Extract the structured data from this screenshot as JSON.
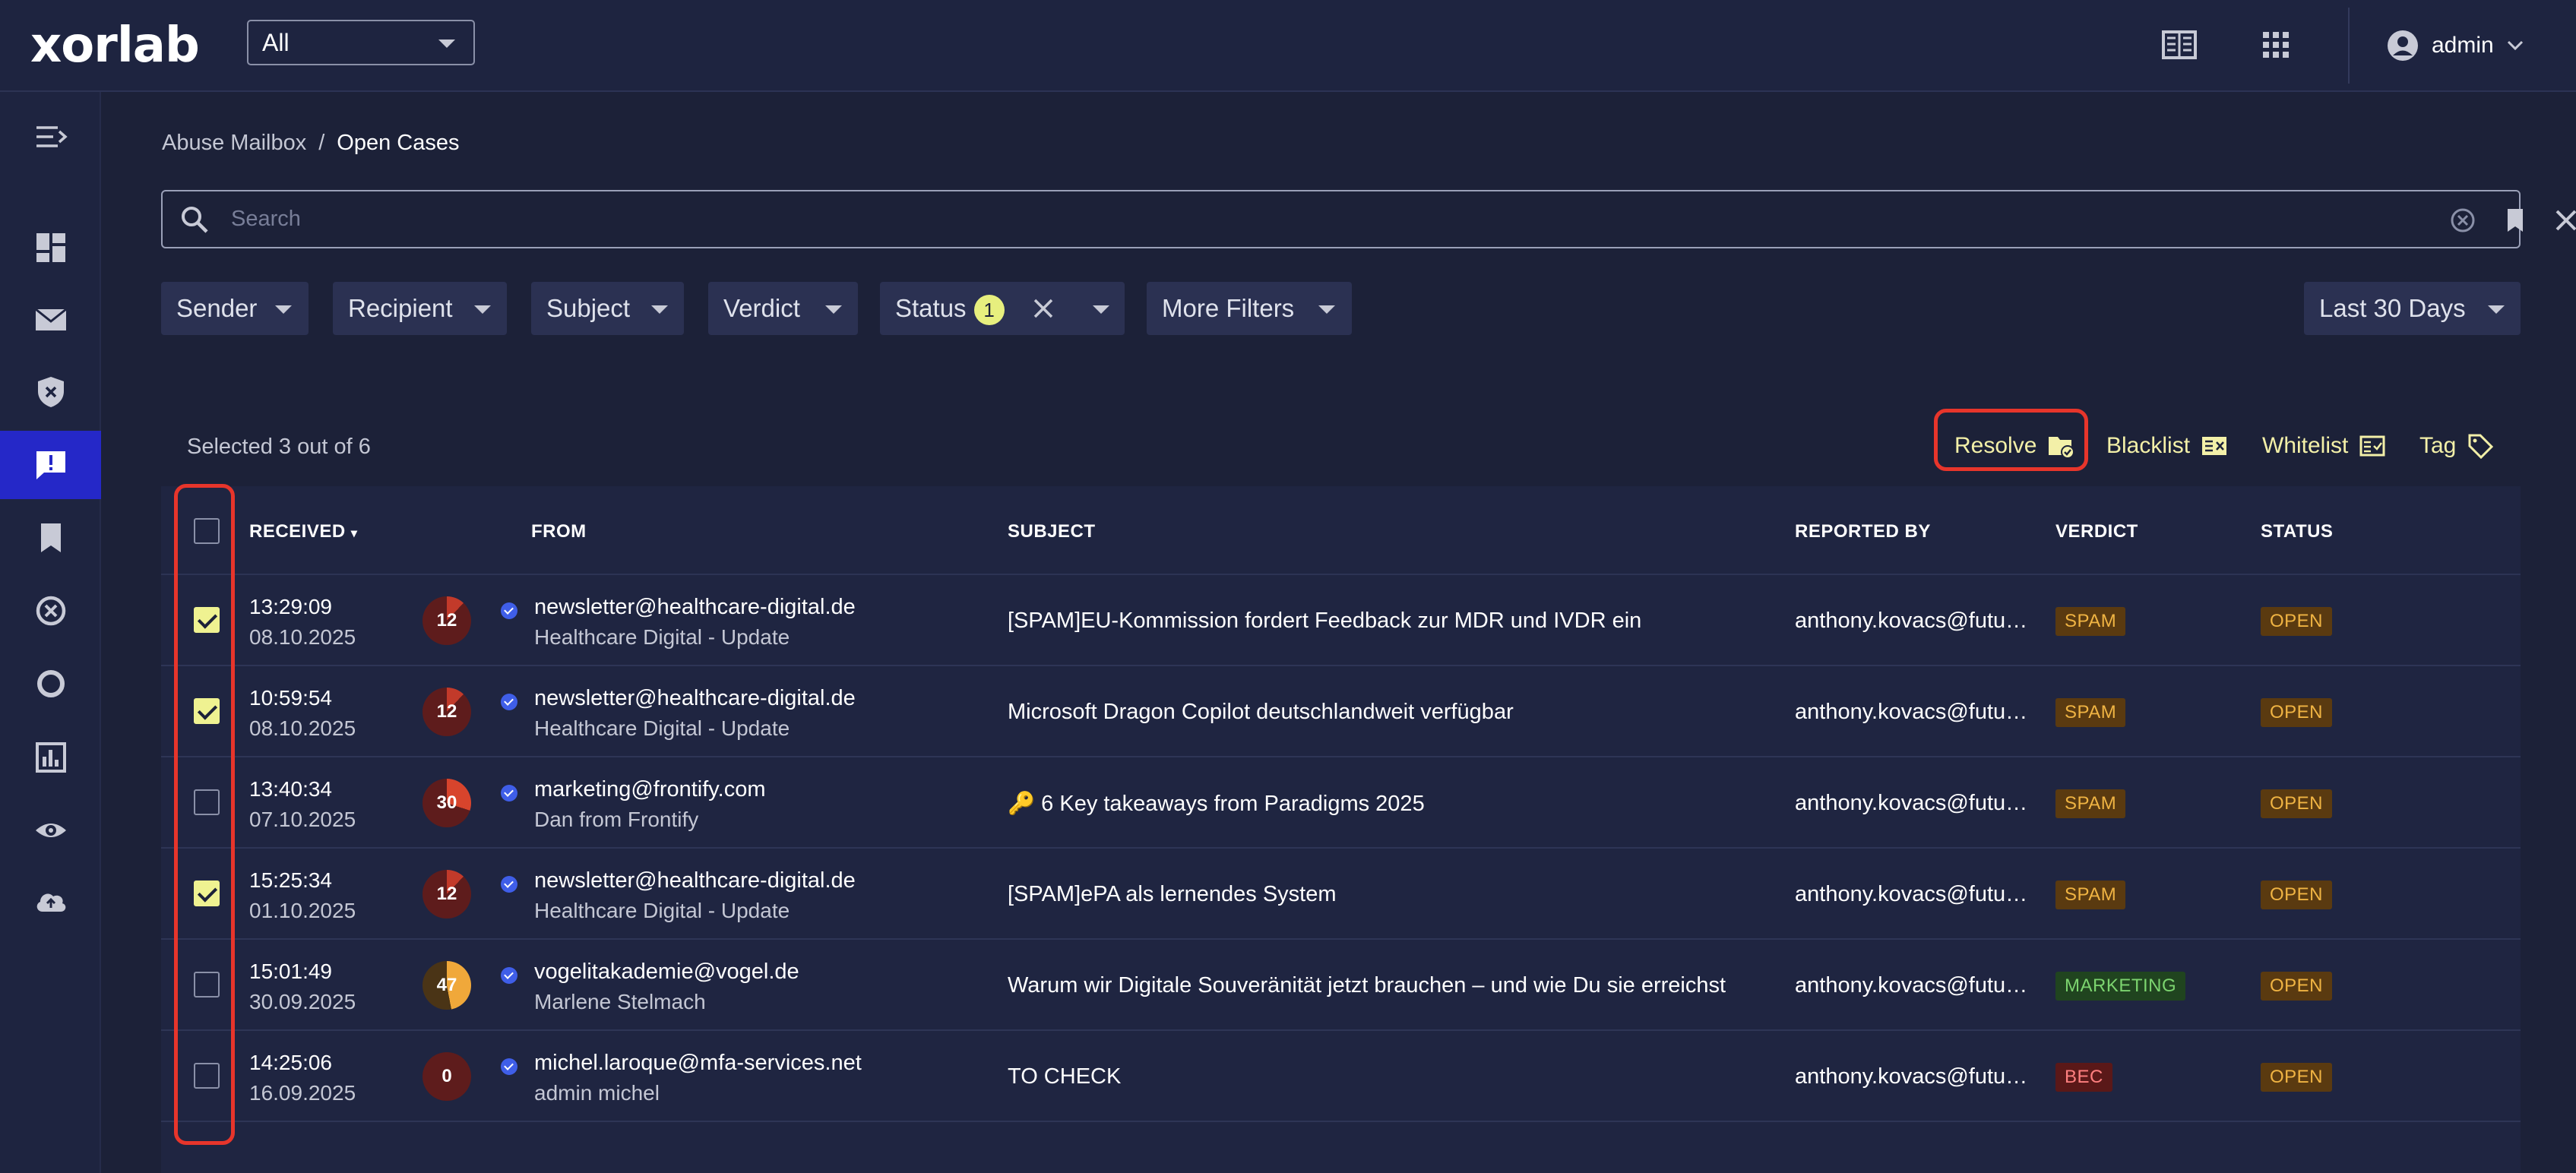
{
  "app": {
    "logo": "xorlab",
    "scope": "All",
    "user": "admin"
  },
  "breadcrumb": {
    "parent": "Abuse Mailbox",
    "separator": "/",
    "current": "Open Cases"
  },
  "search": {
    "placeholder": "Search"
  },
  "filters": {
    "sender": "Sender",
    "recipient": "Recipient",
    "subject": "Subject",
    "verdict": "Verdict",
    "status": "Status",
    "status_count": "1",
    "more": "More Filters",
    "range": "Last 30 Days"
  },
  "toolbar": {
    "selected": "Selected 3 out of 6",
    "resolve": "Resolve",
    "blacklist": "Blacklist",
    "whitelist": "Whitelist",
    "tag": "Tag"
  },
  "table": {
    "headers": {
      "received": "RECEIVED",
      "from": "FROM",
      "subject": "SUBJECT",
      "reported_by": "REPORTED BY",
      "verdict": "VERDICT",
      "status": "STATUS"
    },
    "rows": [
      {
        "time": "13:29:09",
        "date": "08.10.2025",
        "score": "12",
        "from_email": "newsletter@healthcare-digital.de",
        "from_name": "Healthcare Digital - Update",
        "subject": "[SPAM]EU-Kommission fordert Feedback zur MDR und IVDR ein",
        "reported_by": "anthony.kovacs@futur…",
        "verdict": "SPAM",
        "status": "OPEN"
      },
      {
        "time": "10:59:54",
        "date": "08.10.2025",
        "score": "12",
        "from_email": "newsletter@healthcare-digital.de",
        "from_name": "Healthcare Digital - Update",
        "subject": "Microsoft Dragon Copilot deutschlandweit verfügbar",
        "reported_by": "anthony.kovacs@futur…",
        "verdict": "SPAM",
        "status": "OPEN"
      },
      {
        "time": "13:40:34",
        "date": "07.10.2025",
        "score": "30",
        "from_email": "marketing@frontify.com",
        "from_name": "Dan from Frontify",
        "subject": "🔑 6 Key takeaways from Paradigms 2025",
        "reported_by": "anthony.kovacs@futur…",
        "verdict": "SPAM",
        "status": "OPEN"
      },
      {
        "time": "15:25:34",
        "date": "01.10.2025",
        "score": "12",
        "from_email": "newsletter@healthcare-digital.de",
        "from_name": "Healthcare Digital - Update",
        "subject": "[SPAM]ePA als lernendes System",
        "reported_by": "anthony.kovacs@futur…",
        "verdict": "SPAM",
        "status": "OPEN"
      },
      {
        "time": "15:01:49",
        "date": "30.09.2025",
        "score": "47",
        "from_email": "vogelitakademie@vogel.de",
        "from_name": "Marlene Stelmach",
        "subject": "Warum wir Digitale Souveränität jetzt brauchen – und wie Du sie erreichst",
        "reported_by": "anthony.kovacs@futur…",
        "verdict": "MARKETING",
        "status": "OPEN"
      },
      {
        "time": "14:25:06",
        "date": "16.09.2025",
        "score": "0",
        "from_email": "michel.laroque@mfa-services.net",
        "from_name": "admin michel",
        "subject": "TO CHECK",
        "reported_by": "anthony.kovacs@futur…",
        "verdict": "BEC",
        "status": "OPEN"
      }
    ]
  },
  "colors": {
    "accent": "#eff291",
    "active_nav": "#2528c8",
    "highlight": "#e7352b",
    "background": "#1c2138"
  }
}
